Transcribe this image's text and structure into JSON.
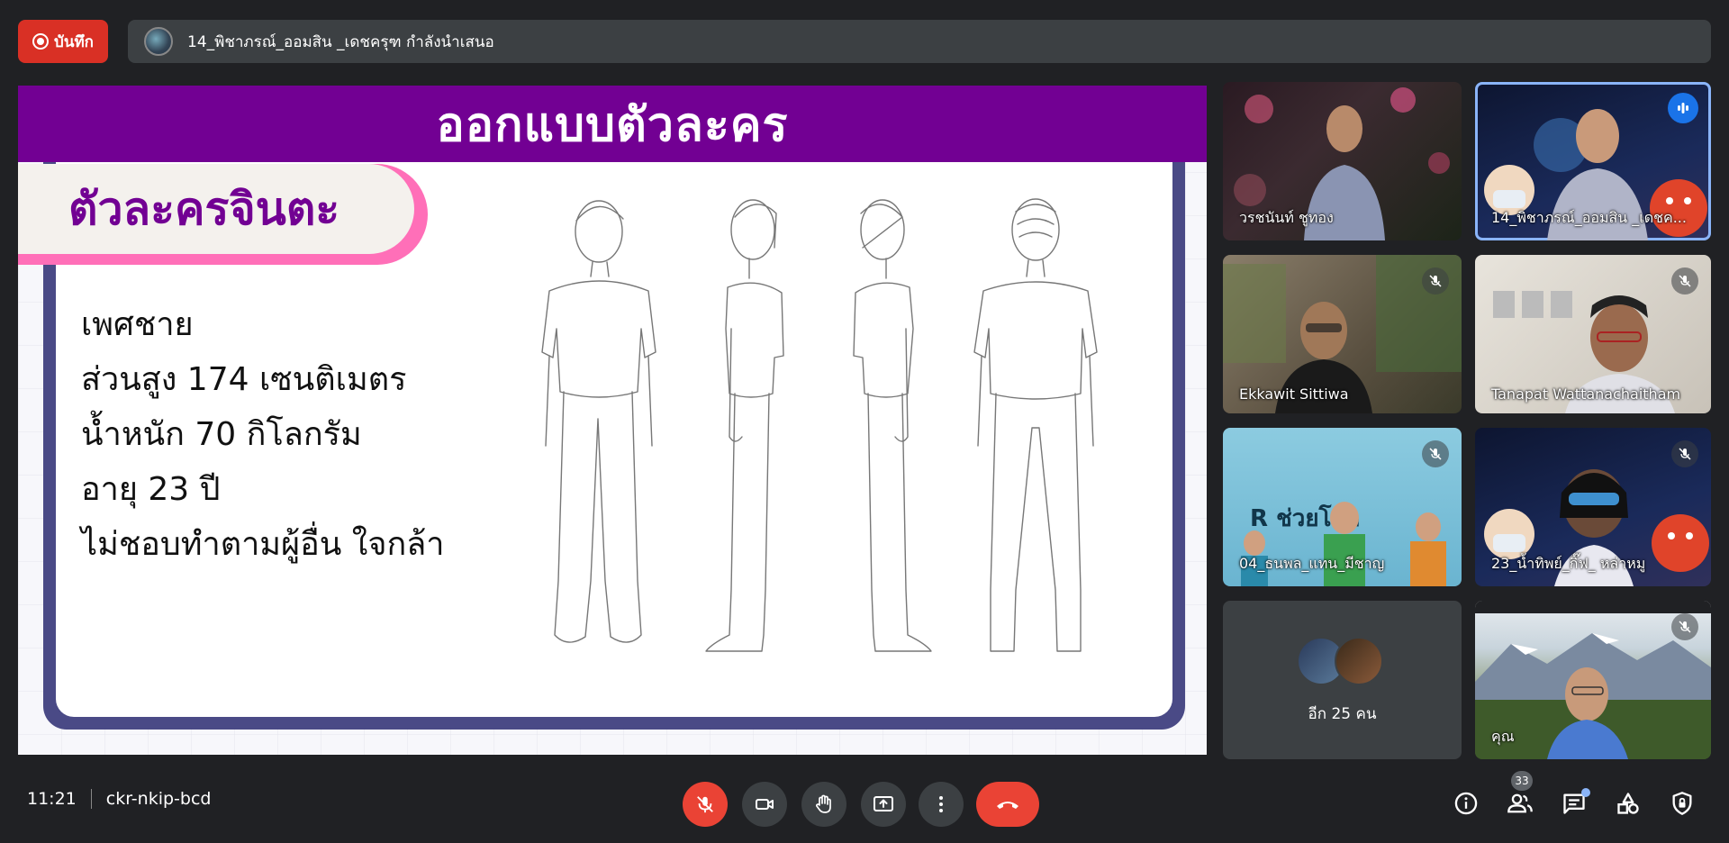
{
  "top_bar": {
    "record_label": "บันทึก",
    "presenting_text": "14_พิชาภรณ์_ออมสิน _เดชครุฑ กำลังนำเสนอ"
  },
  "slide": {
    "title": "ออกแบบตัวละคร",
    "character_name": "ตัวละครจินตะ",
    "lines": [
      "เพศชาย",
      "ส่วนสูง 174 เซนติเมตร",
      "น้ำหนัก 70 กิโลกรัม",
      "อายุ 23 ปี",
      "ไม่ชอบทำตามผู้อื่น ใจกล้า"
    ]
  },
  "participants": [
    {
      "name": "วรชนันท์ ชูทอง",
      "muted": false
    },
    {
      "name": "14_พิชาภรณ์_ออมสิน _เดชค...",
      "muted": false,
      "speaking": true
    },
    {
      "name": "Ekkawit Sittiwa",
      "muted": true
    },
    {
      "name": "Tanapat Wattanachaitham",
      "muted": true
    },
    {
      "name": "04_ธนพล_แทน_มีชาญ",
      "muted": true,
      "bg_text": "R ช่วยโลก"
    },
    {
      "name": "23_น้ำทิพย์_กิ๊ฟ_ หล่าหมู",
      "muted": true
    },
    {
      "name": "อีก 25 คน",
      "muted": false
    },
    {
      "name": "คุณ",
      "muted": true
    }
  ],
  "bottom_bar": {
    "time": "11:21",
    "meeting_code": "ckr-nkip-bcd",
    "participant_count": "33"
  },
  "colors": {
    "slide_purple": "#720093",
    "panel_indigo": "#4a4a86",
    "tab_pink": "#ff6fb8",
    "end_red": "#ea4335",
    "speak_blue": "#1a73e8"
  },
  "icons": [
    "record-icon",
    "mic-off-icon",
    "camera-icon",
    "raise-hand-icon",
    "present-icon",
    "more-options-icon",
    "end-call-icon",
    "info-icon",
    "people-icon",
    "chat-icon",
    "activities-icon",
    "host-controls-icon",
    "speaking-icon"
  ]
}
